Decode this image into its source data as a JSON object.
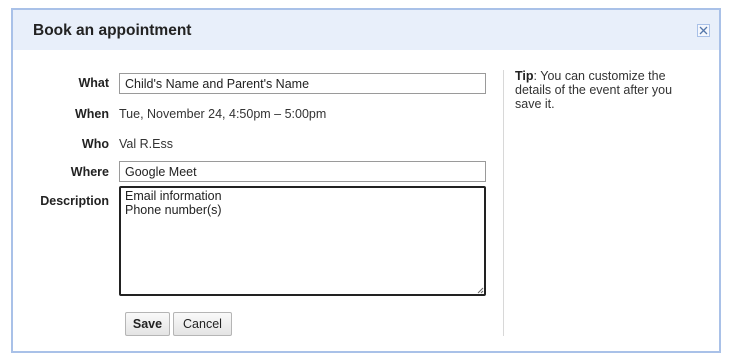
{
  "dialog": {
    "title": "Book an appointment",
    "close_icon": "close-icon"
  },
  "form": {
    "what": {
      "label": "What",
      "value": "Child's Name and Parent's Name"
    },
    "when": {
      "label": "When",
      "value": "Tue, November 24, 4:50pm – 5:00pm"
    },
    "who": {
      "label": "Who",
      "value": "Val R.Ess"
    },
    "where": {
      "label": "Where",
      "value": "Google Meet"
    },
    "description": {
      "label": "Description",
      "value": "Email information\nPhone number(s)"
    }
  },
  "buttons": {
    "save_label": "Save",
    "cancel_label": "Cancel"
  },
  "tip": {
    "heading": "Tip",
    "text": ": You can customize the details of the event after you save it."
  },
  "colors": {
    "title_bar": "#e8effa",
    "dialog_border": "#a9c1e8"
  }
}
